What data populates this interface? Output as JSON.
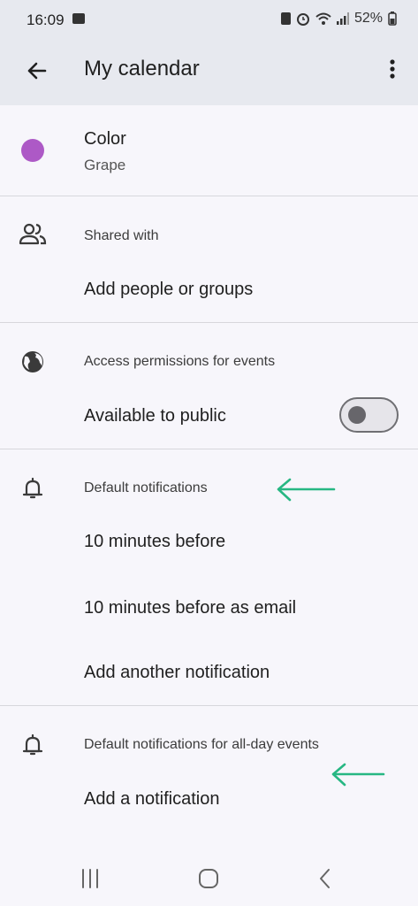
{
  "status_bar": {
    "time": "16:09",
    "battery": "52%"
  },
  "app_bar": {
    "title": "My calendar"
  },
  "color_section": {
    "label": "Color",
    "value": "Grape",
    "color": "#ad59c6"
  },
  "shared_section": {
    "heading": "Shared with",
    "add_label": "Add people or groups"
  },
  "access_section": {
    "heading": "Access permissions for events",
    "public_label": "Available to public",
    "public_enabled": false
  },
  "default_notifications": {
    "heading": "Default notifications",
    "items": [
      "10 minutes before",
      "10 minutes before as email"
    ],
    "add_label": "Add another notification"
  },
  "allday_notifications": {
    "heading": "Default notifications for all-day events",
    "add_label": "Add a notification"
  },
  "annotation": {
    "arrow_color": "#27b783"
  },
  "icons": [
    "back-arrow-icon",
    "more-vert-icon",
    "people-icon",
    "globe-icon",
    "bell-icon",
    "recents-icon",
    "home-icon",
    "nav-back-icon"
  ]
}
